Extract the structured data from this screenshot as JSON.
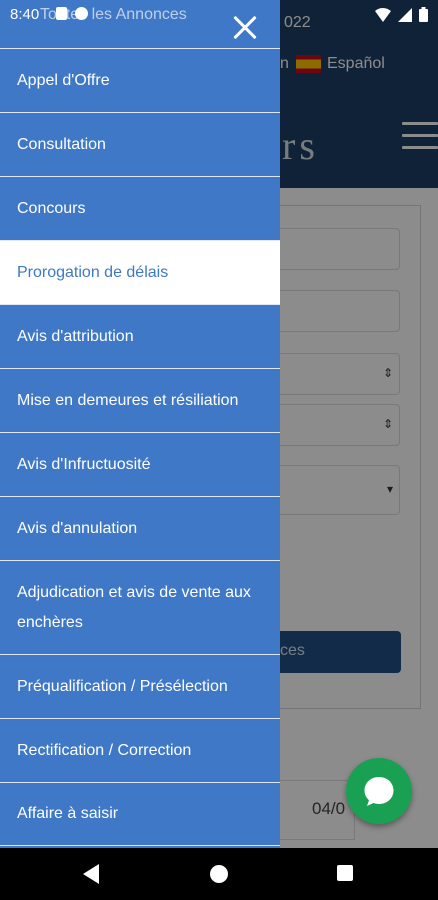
{
  "status_bar": {
    "time": "8:40",
    "ghost_title": "Toutes les Annonces"
  },
  "background": {
    "year_fragment": "022",
    "lang_partial": "n",
    "lang_label": "Español",
    "logo_fragment": "rs",
    "search_button_fragment": "ces",
    "date_fragment": "04/0"
  },
  "drawer": {
    "items": [
      {
        "label": "Appel d'Offre"
      },
      {
        "label": "Consultation"
      },
      {
        "label": "Concours"
      },
      {
        "label": "Prorogation de délais",
        "active": true
      },
      {
        "label": "Avis d'attribution"
      },
      {
        "label": "Mise en demeures et résiliation"
      },
      {
        "label": "Avis d'Infructuosité"
      },
      {
        "label": "Avis d'annulation"
      },
      {
        "label": "Adjudication et avis de vente aux enchères"
      },
      {
        "label": "Préqualification / Présélection"
      },
      {
        "label": "Rectification / Correction"
      },
      {
        "label": "Affaire à saisir"
      }
    ]
  },
  "icons": {
    "close": "close-icon",
    "chat": "chat-bubble-icon",
    "back": "nav-back-icon",
    "home": "nav-home-icon",
    "recents": "nav-recents-icon"
  },
  "colors": {
    "drawer_bg": "#3e78c6",
    "active_item_bg": "#ffffff",
    "active_item_text": "#3e78c6",
    "header_bg": "#1c3f66",
    "chat_fab": "#1aa053"
  }
}
